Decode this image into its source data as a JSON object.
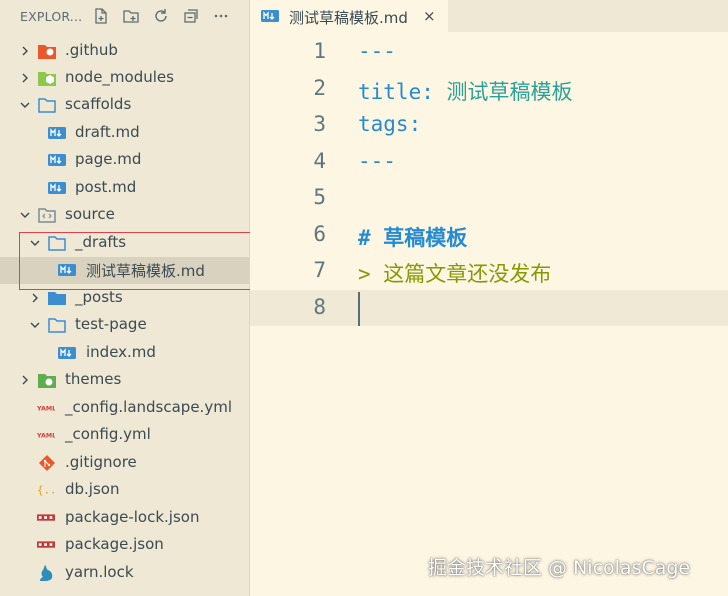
{
  "sidebar": {
    "title": "EXPLOR...",
    "toolbar_icons": [
      "new-file-icon",
      "new-folder-icon",
      "refresh-icon",
      "collapse-all-icon",
      "more-icon"
    ],
    "tree": [
      {
        "label": ".github",
        "icon": "github-folder-icon",
        "type": "folder",
        "expanded": false
      },
      {
        "label": "node_modules",
        "icon": "node-folder-icon",
        "type": "folder",
        "expanded": false
      },
      {
        "label": "scaffolds",
        "icon": "folder-icon",
        "type": "folder",
        "expanded": true
      },
      {
        "label": "draft.md",
        "icon": "markdown-icon",
        "type": "file"
      },
      {
        "label": "page.md",
        "icon": "markdown-icon",
        "type": "file"
      },
      {
        "label": "post.md",
        "icon": "markdown-icon",
        "type": "file"
      },
      {
        "label": "source",
        "icon": "source-folder-icon",
        "type": "folder",
        "expanded": true
      },
      {
        "label": "_drafts",
        "icon": "folder-icon",
        "type": "folder",
        "expanded": true
      },
      {
        "label": "测试草稿模板.md",
        "icon": "markdown-icon",
        "type": "file",
        "selected": true
      },
      {
        "label": "_posts",
        "icon": "folder-icon",
        "type": "folder",
        "expanded": false
      },
      {
        "label": "test-page",
        "icon": "folder-icon",
        "type": "folder",
        "expanded": true
      },
      {
        "label": "index.md",
        "icon": "markdown-icon",
        "type": "file"
      },
      {
        "label": "themes",
        "icon": "themes-folder-icon",
        "type": "folder",
        "expanded": false
      },
      {
        "label": "_config.landscape.yml",
        "icon": "yaml-icon",
        "type": "file"
      },
      {
        "label": "_config.yml",
        "icon": "yaml-icon",
        "type": "file"
      },
      {
        "label": ".gitignore",
        "icon": "git-icon",
        "type": "file"
      },
      {
        "label": "db.json",
        "icon": "json-icon",
        "type": "file"
      },
      {
        "label": "package-lock.json",
        "icon": "npm-icon",
        "type": "file"
      },
      {
        "label": "package.json",
        "icon": "npm-icon",
        "type": "file"
      },
      {
        "label": "yarn.lock",
        "icon": "yarn-icon",
        "type": "file"
      }
    ]
  },
  "tab": {
    "label": "测试草稿模板.md",
    "close": "×",
    "icon": "markdown-icon"
  },
  "editor": {
    "lines": [
      {
        "n": "1",
        "text": "---"
      },
      {
        "n": "2",
        "key": "title:",
        "value": " 测试草稿模板"
      },
      {
        "n": "3",
        "key": "tags:"
      },
      {
        "n": "4",
        "text": "---"
      },
      {
        "n": "5",
        "text": ""
      },
      {
        "n": "6",
        "hash": "#",
        "heading": " 草稿模板"
      },
      {
        "n": "7",
        "quote": ">",
        "quote_text": " 这篇文章还没发布"
      },
      {
        "n": "8",
        "text": ""
      }
    ]
  },
  "watermark": "掘金技术社区 @ NicolasCage",
  "colors": {
    "sidebar_bg": "#eee8d5",
    "editor_bg": "#fdf6e3",
    "highlight_box": "#e0404a",
    "markdown_icon": "#3b8ed0"
  }
}
